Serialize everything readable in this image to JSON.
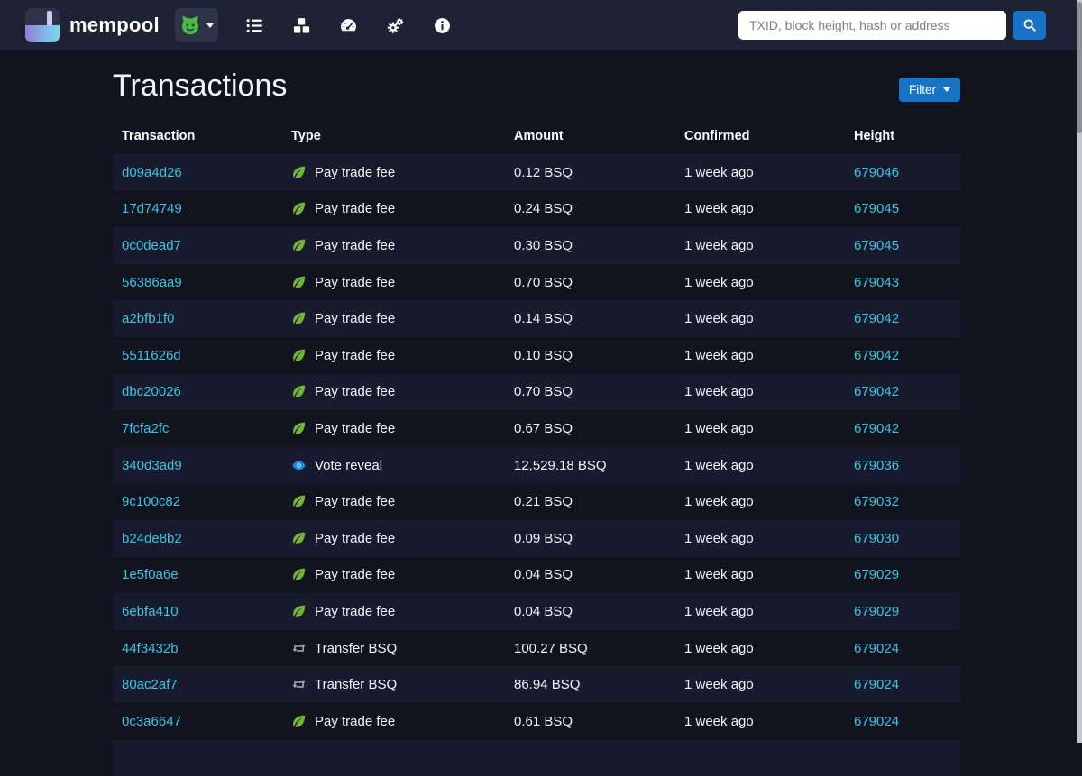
{
  "navbar": {
    "brand": "mempool",
    "network_dropdown": {
      "icon": "bisq-network-icon"
    },
    "nav_items": [
      {
        "icon": "list-icon"
      },
      {
        "icon": "cubes-icon"
      },
      {
        "icon": "gauge-icon"
      },
      {
        "icon": "gears-icon"
      },
      {
        "icon": "info-icon"
      }
    ],
    "search": {
      "placeholder": "TXID, block height, hash or address",
      "button_icon": "search-icon"
    }
  },
  "page": {
    "title": "Transactions",
    "filter_button": "Filter"
  },
  "table": {
    "headers": [
      "Transaction",
      "Type",
      "Amount",
      "Confirmed",
      "Height"
    ],
    "rows": [
      {
        "txid": "d09a4d26",
        "type_icon": "leaf",
        "type": "Pay trade fee",
        "amount": "0.12 BSQ",
        "confirmed": "1 week ago",
        "height": "679046"
      },
      {
        "txid": "17d74749",
        "type_icon": "leaf",
        "type": "Pay trade fee",
        "amount": "0.24 BSQ",
        "confirmed": "1 week ago",
        "height": "679045"
      },
      {
        "txid": "0c0dead7",
        "type_icon": "leaf",
        "type": "Pay trade fee",
        "amount": "0.30 BSQ",
        "confirmed": "1 week ago",
        "height": "679045"
      },
      {
        "txid": "56386aa9",
        "type_icon": "leaf",
        "type": "Pay trade fee",
        "amount": "0.70 BSQ",
        "confirmed": "1 week ago",
        "height": "679043"
      },
      {
        "txid": "a2bfb1f0",
        "type_icon": "leaf",
        "type": "Pay trade fee",
        "amount": "0.14 BSQ",
        "confirmed": "1 week ago",
        "height": "679042"
      },
      {
        "txid": "5511626d",
        "type_icon": "leaf",
        "type": "Pay trade fee",
        "amount": "0.10 BSQ",
        "confirmed": "1 week ago",
        "height": "679042"
      },
      {
        "txid": "dbc20026",
        "type_icon": "leaf",
        "type": "Pay trade fee",
        "amount": "0.70 BSQ",
        "confirmed": "1 week ago",
        "height": "679042"
      },
      {
        "txid": "7fcfa2fc",
        "type_icon": "leaf",
        "type": "Pay trade fee",
        "amount": "0.67 BSQ",
        "confirmed": "1 week ago",
        "height": "679042"
      },
      {
        "txid": "340d3ad9",
        "type_icon": "eye",
        "type": "Vote reveal",
        "amount": "12,529.18 BSQ",
        "confirmed": "1 week ago",
        "height": "679036"
      },
      {
        "txid": "9c100c82",
        "type_icon": "leaf",
        "type": "Pay trade fee",
        "amount": "0.21 BSQ",
        "confirmed": "1 week ago",
        "height": "679032"
      },
      {
        "txid": "b24de8b2",
        "type_icon": "leaf",
        "type": "Pay trade fee",
        "amount": "0.09 BSQ",
        "confirmed": "1 week ago",
        "height": "679030"
      },
      {
        "txid": "1e5f0a6e",
        "type_icon": "leaf",
        "type": "Pay trade fee",
        "amount": "0.04 BSQ",
        "confirmed": "1 week ago",
        "height": "679029"
      },
      {
        "txid": "6ebfa410",
        "type_icon": "leaf",
        "type": "Pay trade fee",
        "amount": "0.04 BSQ",
        "confirmed": "1 week ago",
        "height": "679029"
      },
      {
        "txid": "44f3432b",
        "type_icon": "retweet",
        "type": "Transfer BSQ",
        "amount": "100.27 BSQ",
        "confirmed": "1 week ago",
        "height": "679024"
      },
      {
        "txid": "80ac2af7",
        "type_icon": "retweet",
        "type": "Transfer BSQ",
        "amount": "86.94 BSQ",
        "confirmed": "1 week ago",
        "height": "679024"
      },
      {
        "txid": "0c3a6647",
        "type_icon": "leaf",
        "type": "Pay trade fee",
        "amount": "0.61 BSQ",
        "confirmed": "1 week ago",
        "height": "679024"
      }
    ]
  },
  "colors": {
    "page_bg": "#11131f",
    "navbar_bg": "#1d2234",
    "stripe_row_bg": "#181b2d",
    "link_cyan": "#3bc5e2",
    "leaf_green": "#76b33e",
    "eye_blue": "#1e88e5",
    "transfer_gray": "#a5abb5",
    "primary_button_blue": "#1873c4",
    "bisq_green": "#4db848"
  }
}
